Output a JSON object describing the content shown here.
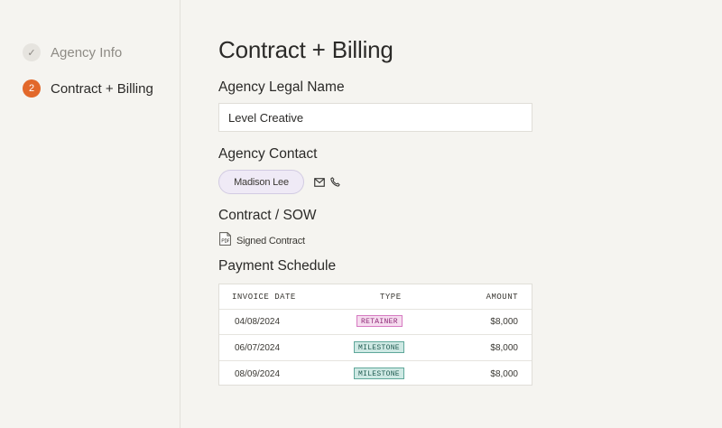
{
  "sidebar": {
    "steps": [
      {
        "label": "Agency Info",
        "indicator": "✓",
        "state": "complete"
      },
      {
        "label": "Contract + Billing",
        "indicator": "2",
        "state": "active"
      }
    ]
  },
  "main": {
    "title": "Contract + Billing",
    "legal_name": {
      "label": "Agency Legal Name",
      "value": "Level Creative"
    },
    "contact": {
      "label": "Agency Contact",
      "name": "Madison Lee",
      "icons": [
        "mail-icon",
        "phone-icon"
      ]
    },
    "contract": {
      "label": "Contract / SOW",
      "file_name": "Signed Contract",
      "file_icon": "pdf-file-icon"
    },
    "payment": {
      "label": "Payment Schedule",
      "columns": [
        "INVOICE DATE",
        "TYPE",
        "AMOUNT"
      ],
      "rows": [
        {
          "date": "04/08/2024",
          "type": "RETAINER",
          "amount": "$8,000"
        },
        {
          "date": "06/07/2024",
          "type": "MILESTONE",
          "amount": "$8,000"
        },
        {
          "date": "08/09/2024",
          "type": "MILESTONE",
          "amount": "$8,000"
        }
      ]
    }
  },
  "colors": {
    "accent": "#e2682a",
    "background": "#f5f4f0",
    "retainer_badge": "#f6dcef",
    "milestone_badge": "#cfe9e4",
    "contact_chip": "#efeaf6"
  }
}
